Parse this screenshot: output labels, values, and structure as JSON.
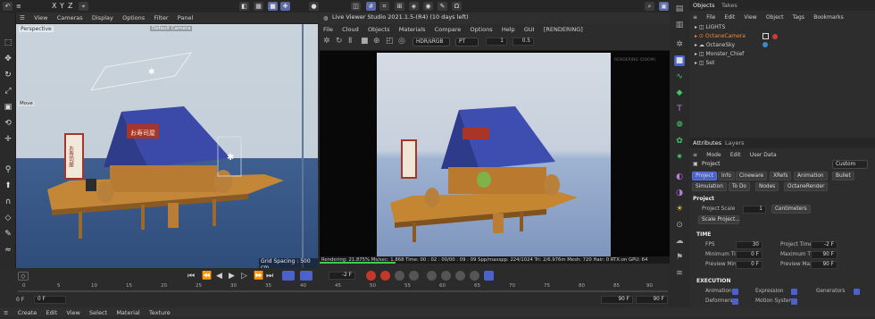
{
  "topbar": {
    "vp_menu": [
      "View",
      "Cameras",
      "Display",
      "Options",
      "Filter",
      "Panel"
    ],
    "xyz": [
      "X",
      "Y",
      "Z"
    ]
  },
  "viewport": {
    "label": "Perspective",
    "cam_label": "Default Camera",
    "move_label": "Move",
    "grid_spacing": "Grid Spacing : 500 cm",
    "sign_text": "お寿司屋",
    "roof_sign": "お寿司屋"
  },
  "live_viewer": {
    "title": "Live Viewer Studio 2021.1.5-(R4) (10 days left)",
    "menu": [
      "File",
      "Cloud",
      "Objects",
      "Materials",
      "Compare",
      "Options",
      "Help",
      "GUI",
      "[RENDERING]"
    ],
    "colorspace": "HDR/sRGB",
    "mode": "PT",
    "val1": "1",
    "val2": "0.5",
    "watermark": "RENDERING (DOOM)",
    "status": "Rendering: 21.875%  Ms/sec: 1.868  Time: 00 : 02 : 00/00 : 09 : 09  Spp/maxspp: 224/1024  Tri: 2/6.976m  Mesh: 720  Hair: 0  RTX:on   GPU: 64"
  },
  "timeline": {
    "frame_current": "0 F",
    "frame_field": "-2 F",
    "start": "0 F",
    "end_a": "90 F",
    "end_b": "90 F",
    "ticks": [
      "0",
      "5",
      "10",
      "15",
      "20",
      "25",
      "30",
      "35",
      "40",
      "45",
      "50",
      "55",
      "60",
      "65",
      "70",
      "75",
      "80",
      "85",
      "90"
    ]
  },
  "bottombar": {
    "items": [
      "Create",
      "Edit",
      "View",
      "Select",
      "Material",
      "Texture"
    ]
  },
  "objects_panel": {
    "tabs": [
      "Objects",
      "Takes"
    ],
    "menu": [
      "File",
      "Edit",
      "View",
      "Object",
      "Tags",
      "Bookmarks"
    ],
    "items": [
      "LIGHTS",
      "OctaneCamera",
      "OctaneSky",
      "Monster_Chief",
      "Set"
    ]
  },
  "attributes_panel": {
    "tabs": [
      "Attributes",
      "Layers"
    ],
    "menu": [
      "Mode",
      "Edit",
      "User Data"
    ],
    "object_name": "Project",
    "custom": "Custom",
    "buttons_row1": [
      "Project",
      "Info",
      "Cineware",
      "XRefs",
      "Animation",
      "Bullet"
    ],
    "buttons_row2": [
      "Simulation",
      "To Do",
      "Nodes",
      "OctaneRender"
    ],
    "section_project": "Project",
    "project_scale_label": "Project Scale",
    "project_scale_value": "1",
    "units": "Centimeters",
    "scale_button": "Scale Project...",
    "section_time": "TIME",
    "fps_label": "FPS",
    "fps_value": "30",
    "project_time_label": "Project Time",
    "project_time_value": "-2 F",
    "min_time_label": "Minimum Time",
    "min_time_value": "0 F",
    "max_time_label": "Maximum Time",
    "max_time_value": "90 F",
    "preview_min_label": "Preview Min",
    "preview_min_value": "0 F",
    "preview_max_label": "Preview Max",
    "preview_max_value": "90 F",
    "section_exec": "EXECUTION",
    "exec_items": [
      "Animation",
      "Expression",
      "Generators",
      "Deformers",
      "Motion System"
    ]
  },
  "colors": {
    "accent": "#4a62c9",
    "roof": "#3b4aa8",
    "wood": "#c98a3c",
    "water": "#3e5f8f"
  }
}
